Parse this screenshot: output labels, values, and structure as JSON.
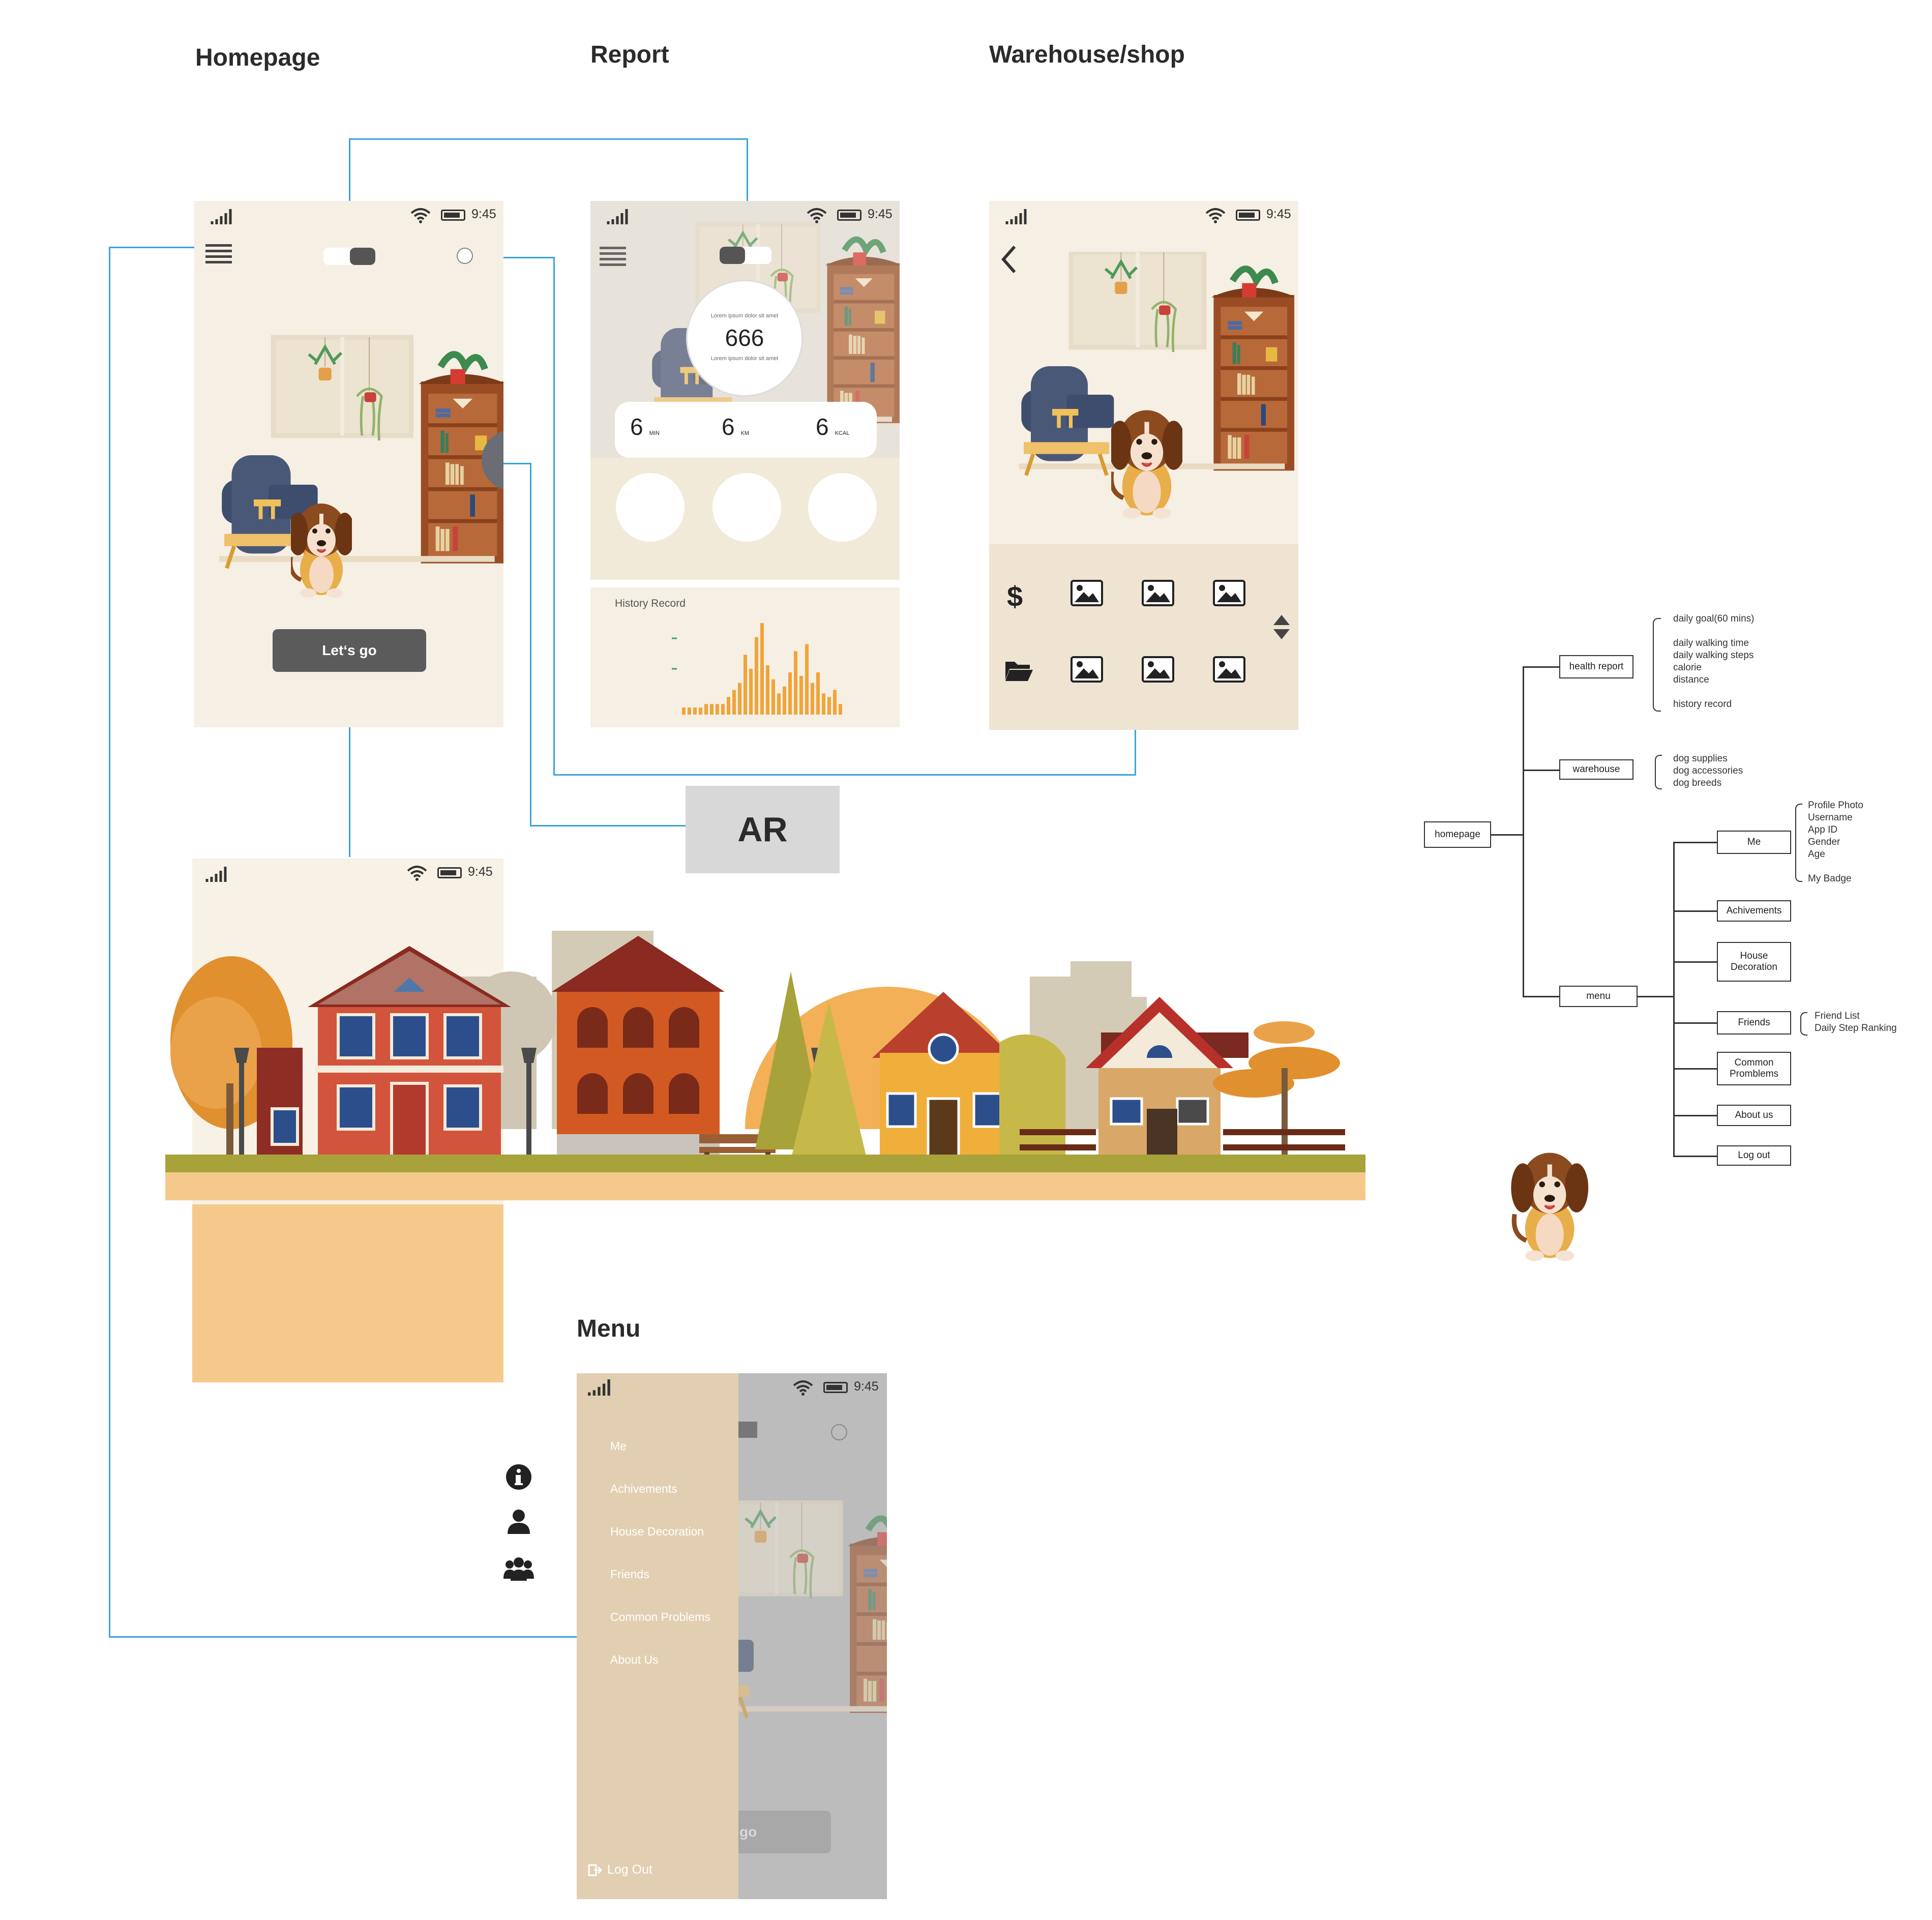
{
  "titles": {
    "homepage": "Homepage",
    "report": "Report",
    "warehouse": "Warehouse/shop",
    "menu": "Menu"
  },
  "status": {
    "time": "9:45"
  },
  "homepage": {
    "cta": "Let‘s go"
  },
  "report": {
    "circle_top": "Lorem ipsum dolor sit amet",
    "circle_value": "666",
    "circle_bottom": "Lorem ipsum dolor sit amet",
    "stats": [
      {
        "value": "6",
        "unit": "MIN"
      },
      {
        "value": "6",
        "unit": "KM"
      },
      {
        "value": "6",
        "unit": "KCAL"
      }
    ],
    "history_title": "History Record"
  },
  "chart_data": {
    "type": "bar",
    "values": [
      2,
      2,
      2,
      2,
      3,
      3,
      3,
      3,
      5,
      7,
      9,
      17,
      13,
      22,
      26,
      14,
      10,
      6,
      8,
      12,
      18,
      11,
      20,
      9,
      12,
      6,
      5,
      7,
      3
    ]
  },
  "ar": {
    "label": "AR"
  },
  "menu": {
    "items": [
      "Me",
      "Achivements",
      "House Decoration",
      "Friends",
      "Common Problems",
      "About Us"
    ],
    "logout": "Log Out",
    "bg_button_text": "go"
  },
  "sitemap": {
    "root": "homepage",
    "health_report": "health report",
    "health_notes": [
      "daily goal(60 mins)",
      "",
      "daily walking time",
      "daily walking steps",
      "calorie",
      "distance",
      "",
      "history record"
    ],
    "warehouse": "warehouse",
    "warehouse_notes": [
      "dog supplies",
      "dog accessories",
      "dog breeds"
    ],
    "menu": "menu",
    "me": "Me",
    "me_notes": [
      "Profile Photo",
      "Username",
      "App ID",
      "Gender",
      "Age",
      "",
      "My Badge"
    ],
    "achievements": "Achivements",
    "house_decoration": [
      "House",
      "Decoration"
    ],
    "friends": "Friends",
    "friends_notes": [
      "Friend List",
      "Daily Step Ranking"
    ],
    "common_problems": [
      "Common",
      "Promblems"
    ],
    "about_us": "About us",
    "log_out": "Log out"
  },
  "icons": [
    "signal-icon",
    "wifi-icon",
    "battery-icon",
    "hamburger-icon",
    "toggle-icon",
    "circle-icon",
    "back-icon",
    "dollar-icon",
    "folder-icon",
    "image-icon",
    "sort-arrows-icon",
    "info-icon",
    "user-icon",
    "group-icon",
    "logout-icon"
  ]
}
